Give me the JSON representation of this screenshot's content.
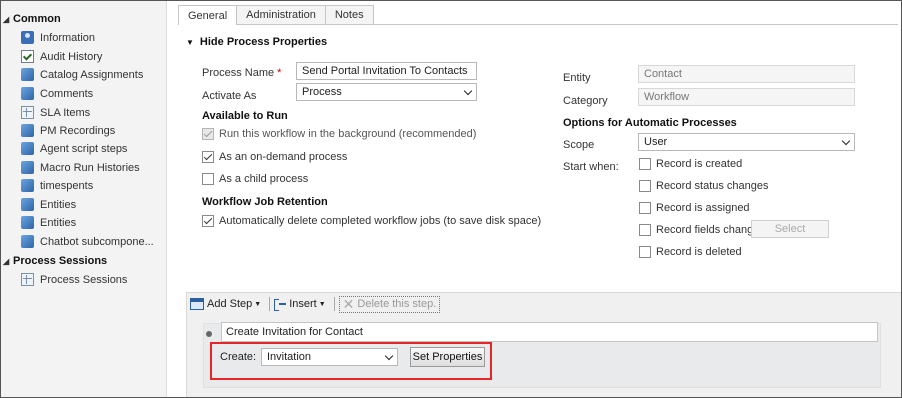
{
  "sidebar": {
    "common_header": "Common",
    "common_items": [
      {
        "label": "Information",
        "icon": "info-form-icon"
      },
      {
        "label": "Audit History",
        "icon": "audit-history-icon"
      },
      {
        "label": "Catalog Assignments",
        "icon": "entity-icon"
      },
      {
        "label": "Comments",
        "icon": "entity-icon"
      },
      {
        "label": "SLA Items",
        "icon": "sla-items-icon"
      },
      {
        "label": "PM Recordings",
        "icon": "entity-icon"
      },
      {
        "label": "Agent script steps",
        "icon": "entity-icon"
      },
      {
        "label": "Macro Run Histories",
        "icon": "entity-icon"
      },
      {
        "label": "timespents",
        "icon": "entity-icon"
      },
      {
        "label": "Entities",
        "icon": "entity-icon"
      },
      {
        "label": "Entities",
        "icon": "entity-icon"
      },
      {
        "label": "Chatbot subcompone...",
        "icon": "entity-icon"
      }
    ],
    "process_header": "Process Sessions",
    "process_items": [
      {
        "label": "Process Sessions",
        "icon": "process-sessions-icon"
      }
    ]
  },
  "tabs": [
    {
      "label": "General",
      "active": true
    },
    {
      "label": "Administration",
      "active": false
    },
    {
      "label": "Notes",
      "active": false
    }
  ],
  "section": {
    "title": "Hide Process Properties"
  },
  "form": {
    "process_name_label": "Process Name",
    "required_marker": "*",
    "process_name_value": "Send Portal Invitation To Contacts",
    "activate_as_label": "Activate As",
    "activate_as_value": "Process",
    "available_to_run_header": "Available to Run",
    "run_background_label": "Run this workflow in the background (recommended)",
    "on_demand_label": "As an on-demand process",
    "child_process_label": "As a child process",
    "job_retention_header": "Workflow Job Retention",
    "auto_delete_label": "Automatically delete completed workflow jobs (to save disk space)",
    "checkbox_states": {
      "run_background": true,
      "on_demand": true,
      "child_process": false,
      "auto_delete": true
    }
  },
  "right": {
    "entity_label": "Entity",
    "entity_value": "Contact",
    "category_label": "Category",
    "category_value": "Workflow",
    "options_header": "Options for Automatic Processes",
    "scope_label": "Scope",
    "scope_value": "User",
    "start_when_label": "Start when:",
    "start_options": [
      "Record is created",
      "Record status changes",
      "Record is assigned",
      "Record fields change",
      "Record is deleted"
    ],
    "select_button": "Select"
  },
  "steps": {
    "toolbar": {
      "add_step": "Add Step",
      "insert": "Insert",
      "delete": "Delete this step."
    },
    "step_name": "Create Invitation for Contact",
    "create_label": "Create:",
    "create_value": "Invitation",
    "set_properties": "Set Properties"
  },
  "colors": {
    "highlight_box": "#e4262b",
    "sidebar_bg": "#f3f3f3",
    "required": "#cc0000"
  }
}
